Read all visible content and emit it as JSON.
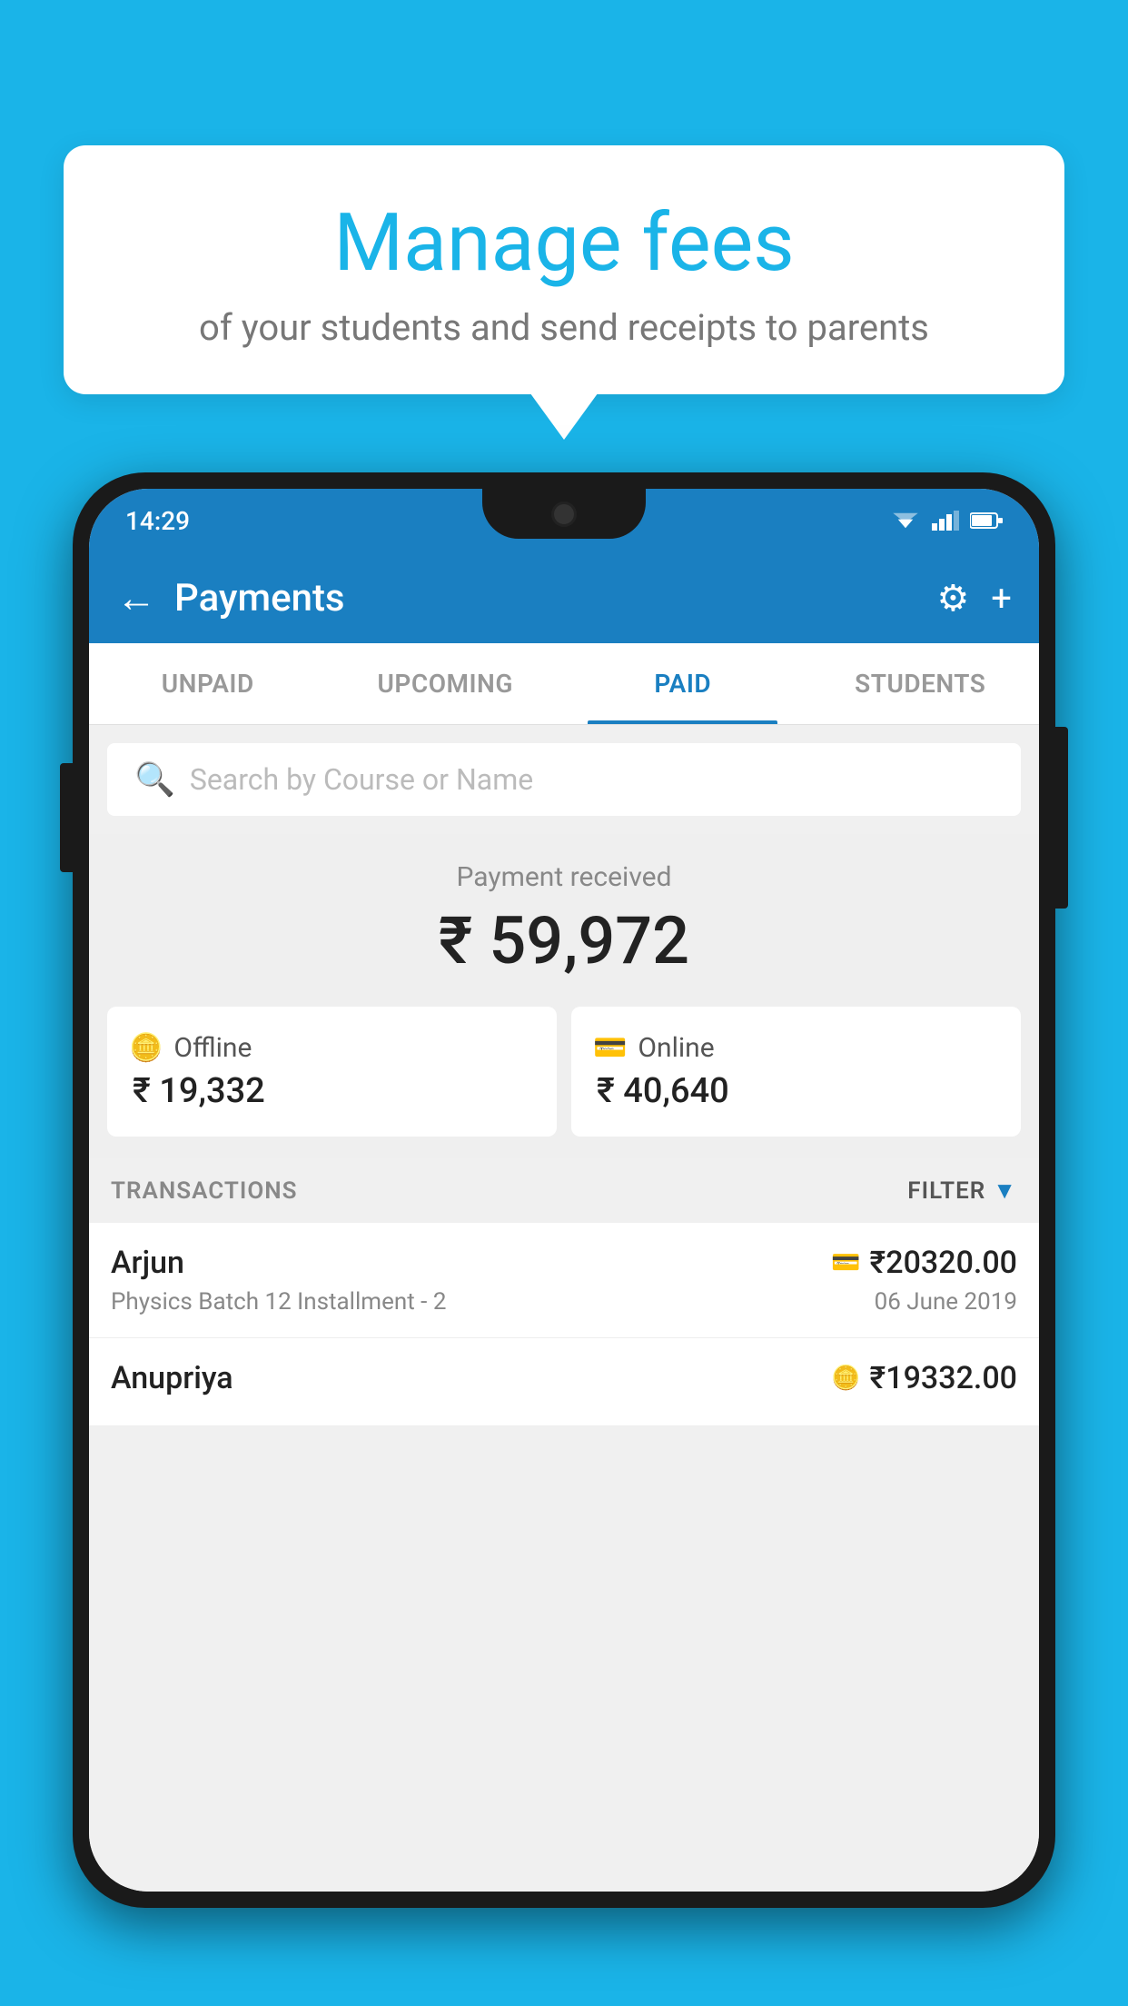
{
  "background_color": "#1ab4e8",
  "bubble": {
    "headline": "Manage fees",
    "subtext": "of your students and send receipts to parents"
  },
  "status_bar": {
    "time": "14:29"
  },
  "app_bar": {
    "title": "Payments",
    "settings_icon": "⚙",
    "add_icon": "+"
  },
  "tabs": [
    {
      "label": "UNPAID",
      "active": false
    },
    {
      "label": "UPCOMING",
      "active": false
    },
    {
      "label": "PAID",
      "active": true
    },
    {
      "label": "STUDENTS",
      "active": false
    }
  ],
  "search": {
    "placeholder": "Search by Course or Name"
  },
  "payment_summary": {
    "label": "Payment received",
    "amount": "₹ 59,972",
    "offline_label": "Offline",
    "offline_amount": "₹ 19,332",
    "online_label": "Online",
    "online_amount": "₹ 40,640"
  },
  "transactions_section": {
    "label": "TRANSACTIONS",
    "filter_label": "FILTER"
  },
  "transactions": [
    {
      "name": "Arjun",
      "amount": "₹20320.00",
      "course": "Physics Batch 12 Installment - 2",
      "date": "06 June 2019",
      "payment_type": "online"
    },
    {
      "name": "Anupriya",
      "amount": "₹19332.00",
      "course": "",
      "date": "",
      "payment_type": "offline"
    }
  ]
}
